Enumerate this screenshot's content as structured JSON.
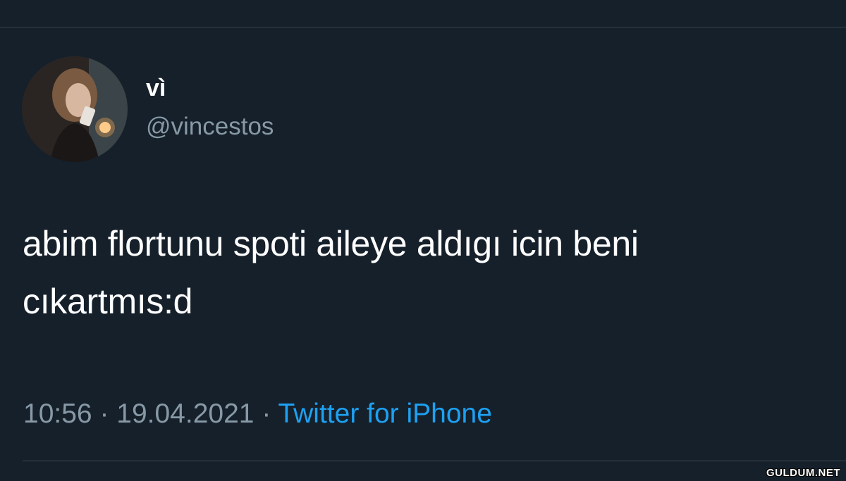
{
  "tweet": {
    "display_name": "vì",
    "username": "@vincestos",
    "text_line1": "abim flortunu spoti aileye aldıgı icin beni",
    "text_line2": "cıkartmıs:d",
    "time": "10:56",
    "separator": " · ",
    "date": "19.04.2021",
    "source": "Twitter for iPhone"
  },
  "watermark": "GULDUM.NET",
  "colors": {
    "background": "#15202b",
    "muted_text": "#8899a6",
    "link": "#1da1f2",
    "divider": "#38444d"
  }
}
